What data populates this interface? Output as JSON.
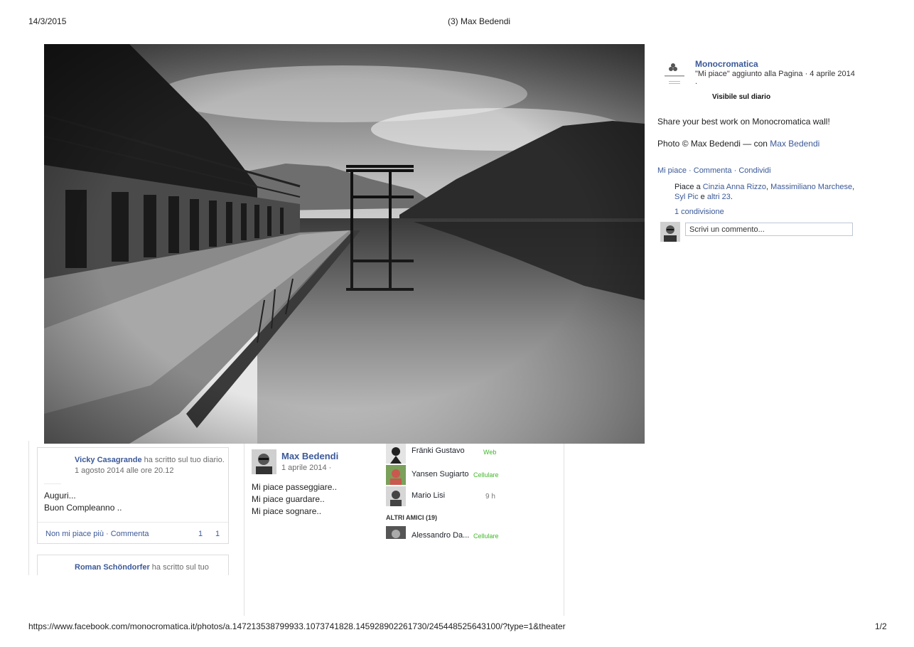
{
  "print": {
    "date": "14/3/2015",
    "title": "(3) Max Bedendi",
    "url": "https://www.facebook.com/monocromatica.it/photos/a.147213538799933.1073741828.145928902261730/245448525643100/?type=1&theater",
    "page_number": "1/2"
  },
  "theater": {
    "page_name": "Monocromatica",
    "liked_info": "\"Mi piace\" aggiunto alla Pagina · 4 aprile 2014",
    "liked_info_tail": ".",
    "visibility": "Visibile sul diario",
    "caption": "Share your best work on Monocromatica wall!",
    "photo_credit": "Photo © Max Bedendi — con",
    "tagged_name": "Max Bedendi",
    "actions": {
      "like": "Mi piace",
      "sep1": " · ",
      "comment": "Commenta",
      "sep2": " · ",
      "share": "Condividi"
    },
    "likes": {
      "prefix": "Piace a",
      "name1": "Cinzia Anna Rizzo",
      "comma1": ",",
      "name2": "Massimiliano Marchese",
      "comma2": ",",
      "name3": "Syl Pic",
      "and": " e ",
      "others": "altri 23",
      "dot": "."
    },
    "shares": "1 condivisione",
    "comment_placeholder": "Scrivi un commento..."
  },
  "timeline": {
    "post1": {
      "author": "Vicky Casagrande",
      "action": "ha scritto sul tuo diario.",
      "date": "1 agosto 2014 alle ore 20.12",
      "line1": "Auguri...",
      "line2": "Buon Compleanno ..",
      "unlike": "Non mi piace più",
      "sep": " · ",
      "comment": "Commenta",
      "count1": "1",
      "count2": "1"
    },
    "post2": {
      "author": "Roman Schöndorfer",
      "action": "ha scritto sul tuo"
    },
    "post3": {
      "author": "Max Bedendi",
      "date": "1 aprile 2014 ·",
      "line1": "Mi piace passeggiare..",
      "line2": "Mi piace guardare..",
      "line3": "Mi piace sognare.."
    }
  },
  "chat": {
    "friends": [
      {
        "name": "Fränki Gustavo",
        "status": "Web"
      },
      {
        "name": "Yansen Sugiarto",
        "status": "Cellulare"
      },
      {
        "name": "Mario Lisi",
        "status": "9 h"
      }
    ],
    "other_header": "ALTRI AMICI (19)",
    "other_friends": [
      {
        "name": "Alessandro Da...",
        "status": "Cellulare"
      }
    ]
  },
  "colors": {
    "link": "#3b5998",
    "online_green": "#42b72a"
  }
}
